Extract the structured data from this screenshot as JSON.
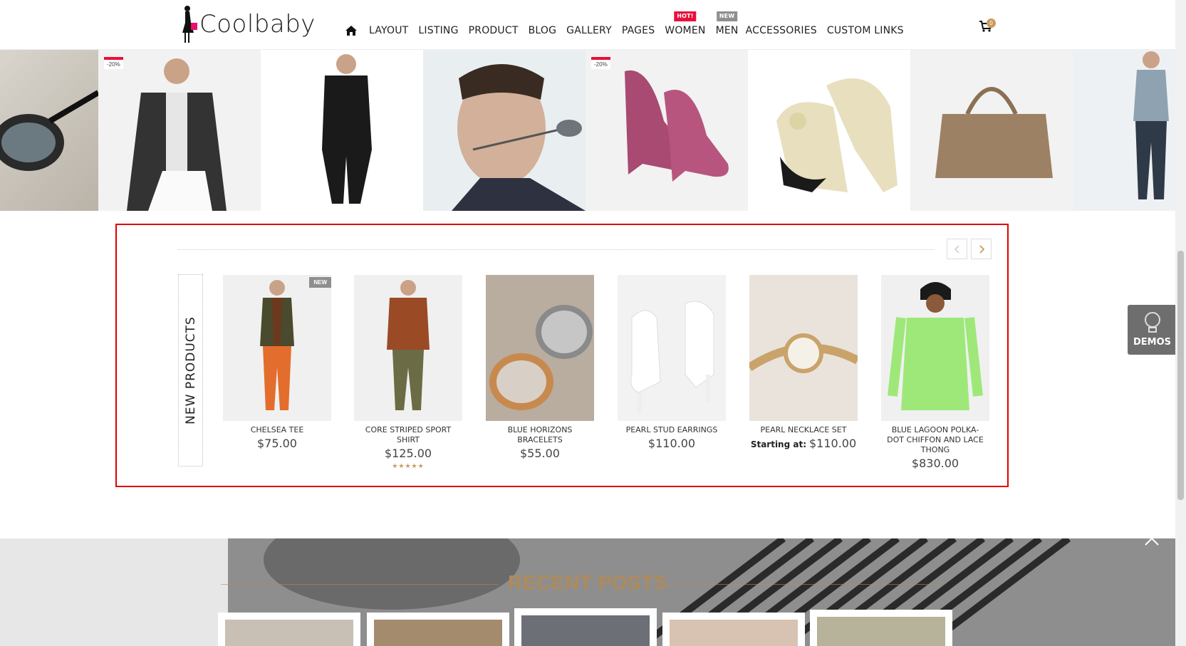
{
  "brand": {
    "name": "Coolbaby"
  },
  "nav": {
    "items": [
      {
        "label": "LAYOUT"
      },
      {
        "label": "LISTING"
      },
      {
        "label": "PRODUCT"
      },
      {
        "label": "BLOG"
      },
      {
        "label": "GALLERY"
      },
      {
        "label": "PAGES"
      },
      {
        "label": "WOMEN",
        "badge": "HOT!"
      },
      {
        "label": "MEN",
        "badge": "NEW"
      },
      {
        "label": "ACCESSORIES"
      },
      {
        "label": "CUSTOM LINKS"
      }
    ],
    "cart_count": "0"
  },
  "banner": {
    "sale_flags": [
      "-20%",
      "-20%"
    ]
  },
  "new_products": {
    "heading": "NEW PRODUCTS",
    "items": [
      {
        "name": "CHELSEA TEE",
        "price": "$75.00",
        "tag": "NEW"
      },
      {
        "name": "CORE STRIPED SPORT SHIRT",
        "price": "$125.00",
        "rating": "★★★★★"
      },
      {
        "name": "BLUE HORIZONS BRACELETS",
        "price": "$55.00"
      },
      {
        "name": "PEARL STUD EARRINGS",
        "price": "$110.00"
      },
      {
        "name": "PEARL NECKLACE SET",
        "price_prefix": "Starting at:",
        "price": "$110.00"
      },
      {
        "name": "BLUE LAGOON POLKA-DOT CHIFFON AND LACE THONG",
        "price": "$830.00"
      }
    ]
  },
  "demos": {
    "label": "DEMOS"
  },
  "recent_posts": {
    "title": "RECENT POSTS"
  },
  "colors": {
    "accent": "#c89a5b",
    "hot": "#e8103a",
    "highlight_border": "#e00000"
  }
}
